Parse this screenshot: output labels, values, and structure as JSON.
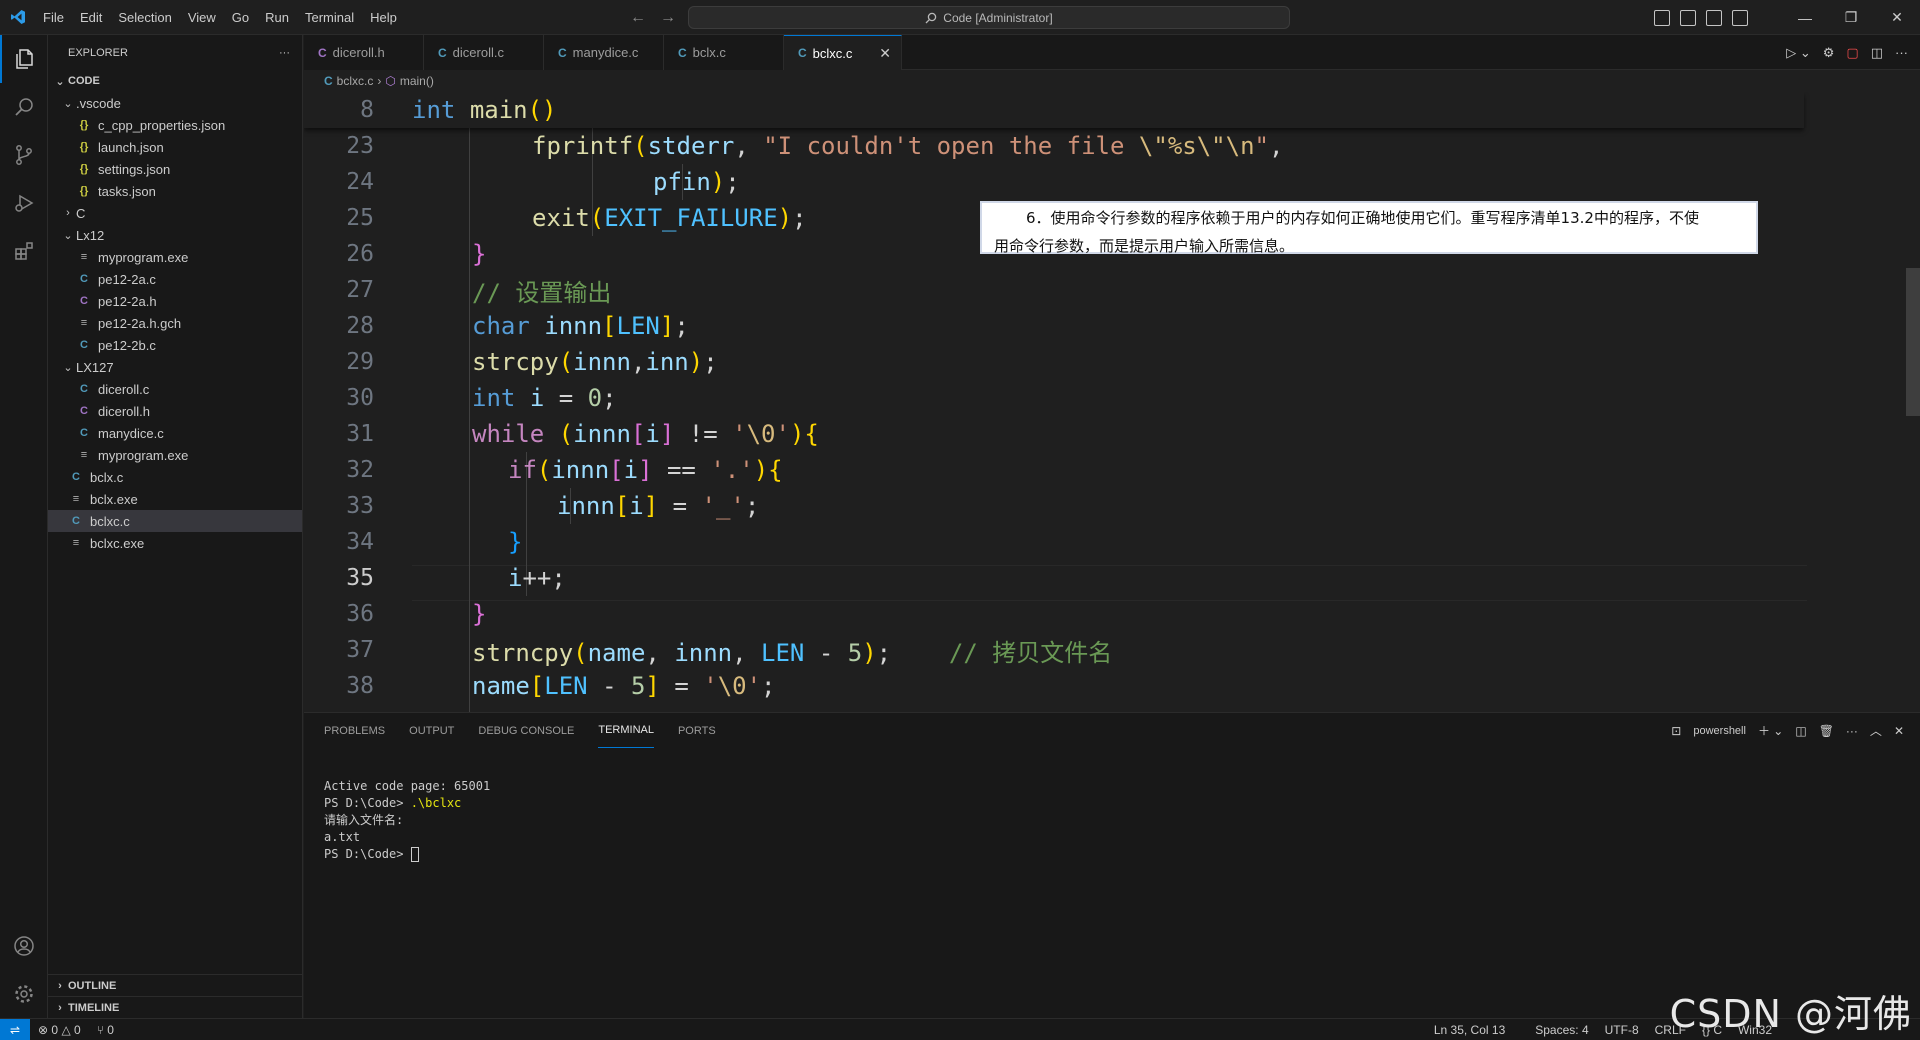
{
  "titlebar": {
    "menu": [
      "File",
      "Edit",
      "Selection",
      "View",
      "Go",
      "Run",
      "Terminal",
      "Help"
    ],
    "command_center": "Code [Administrator]"
  },
  "explorer": {
    "title": "EXPLORER",
    "more": "···",
    "root": "CODE",
    "tree": [
      {
        "label": ".vscode",
        "type": "folder",
        "depth": 1,
        "open": true
      },
      {
        "label": "c_cpp_properties.json",
        "type": "json",
        "depth": 2
      },
      {
        "label": "launch.json",
        "type": "json",
        "depth": 2
      },
      {
        "label": "settings.json",
        "type": "json",
        "depth": 2
      },
      {
        "label": "tasks.json",
        "type": "json",
        "depth": 2
      },
      {
        "label": "C",
        "type": "folder",
        "depth": 1,
        "open": false
      },
      {
        "label": "Lx12",
        "type": "folder",
        "depth": 1,
        "open": true
      },
      {
        "label": "myprogram.exe",
        "type": "exe",
        "depth": 2
      },
      {
        "label": "pe12-2a.c",
        "type": "c",
        "depth": 2
      },
      {
        "label": "pe12-2a.h",
        "type": "h",
        "depth": 2
      },
      {
        "label": "pe12-2a.h.gch",
        "type": "exe",
        "depth": 2
      },
      {
        "label": "pe12-2b.c",
        "type": "c",
        "depth": 2
      },
      {
        "label": "LX127",
        "type": "folder",
        "depth": 1,
        "open": true
      },
      {
        "label": "diceroll.c",
        "type": "c",
        "depth": 2
      },
      {
        "label": "diceroll.h",
        "type": "h",
        "depth": 2
      },
      {
        "label": "manydice.c",
        "type": "c",
        "depth": 2
      },
      {
        "label": "myprogram.exe",
        "type": "exe",
        "depth": 2
      },
      {
        "label": "bclx.c",
        "type": "c",
        "depth": 1
      },
      {
        "label": "bclx.exe",
        "type": "exe",
        "depth": 1
      },
      {
        "label": "bclxc.c",
        "type": "c",
        "depth": 1,
        "selected": true
      },
      {
        "label": "bclxc.exe",
        "type": "exe",
        "depth": 1
      }
    ],
    "outline": "OUTLINE",
    "timeline": "TIMELINE"
  },
  "tabs": [
    {
      "label": "diceroll.h",
      "icon": "C"
    },
    {
      "label": "diceroll.c",
      "icon": "C"
    },
    {
      "label": "manydice.c",
      "icon": "C"
    },
    {
      "label": "bclx.c",
      "icon": "C"
    },
    {
      "label": "bclxc.c",
      "icon": "C",
      "active": true
    }
  ],
  "breadcrumb": {
    "file": "bclxc.c",
    "icon": "C",
    "symbol": "main()"
  },
  "editor": {
    "sticky_line": {
      "num": "8",
      "text": "int main()"
    },
    "lines": [
      {
        "num": "23",
        "text": "fprintf(stderr, \"I couldn't open the file \\\"%s\\\"\\n\","
      },
      {
        "num": "24",
        "text": "pfin);"
      },
      {
        "num": "25",
        "text": "exit(EXIT_FAILURE);"
      },
      {
        "num": "26",
        "text": "}"
      },
      {
        "num": "27",
        "text": "// 设置输出"
      },
      {
        "num": "28",
        "text": "char innn[LEN];"
      },
      {
        "num": "29",
        "text": "strcpy(innn,inn);"
      },
      {
        "num": "30",
        "text": "int i = 0;"
      },
      {
        "num": "31",
        "text": "while (innn[i] != '\\0'){"
      },
      {
        "num": "32",
        "text": "if(innn[i] == '.'){"
      },
      {
        "num": "33",
        "text": "innn[i] = '_';"
      },
      {
        "num": "34",
        "text": "}"
      },
      {
        "num": "35",
        "text": "i++;"
      },
      {
        "num": "36",
        "text": "}"
      },
      {
        "num": "37",
        "text": "strncpy(name, innn, LEN - 5);    // 拷贝文件名"
      },
      {
        "num": "38",
        "text": "name[LEN - 5] = '\\0';"
      }
    ],
    "overlay_line1": "6．使用命令行参数的程序依赖于用户的内存如何正确地使用它们。重写程序清单13.2中的程序，不使",
    "overlay_line2": "用命令行参数，而是提示用户输入所需信息。"
  },
  "panel": {
    "tabs": [
      "PROBLEMS",
      "OUTPUT",
      "DEBUG CONSOLE",
      "TERMINAL",
      "PORTS"
    ],
    "active_tab": "TERMINAL",
    "shell": "powershell",
    "terminal": {
      "line1": "Active code page: 65001",
      "line2_prompt": "PS D:\\Code> ",
      "line2_cmd": ".\\bclxc",
      "line3": "请输入文件名:",
      "line4": "a.txt",
      "line5_prompt": "PS D:\\Code> "
    }
  },
  "statusbar": {
    "errors": "0",
    "warnings": "0",
    "ports": "0",
    "position": "Ln 35, Col 13",
    "spaces": "Spaces: 4",
    "encoding": "UTF-8",
    "eol": "CRLF",
    "language": "{} C",
    "platform": "Win32"
  },
  "watermark": "CSDN @河佛",
  "colors": {
    "accent": "#0078d4",
    "background": "#1f1f1f",
    "sidebar": "#181818"
  }
}
